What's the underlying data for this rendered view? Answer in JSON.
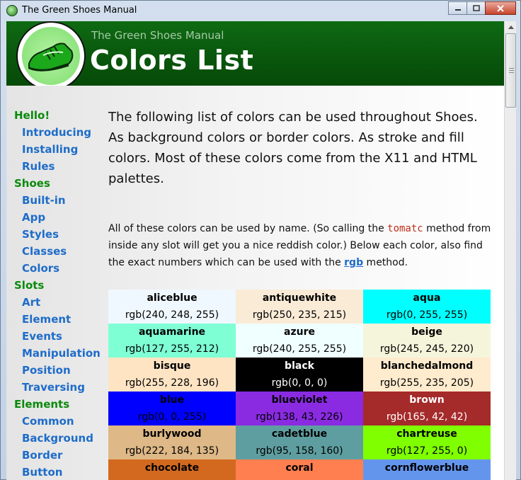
{
  "window": {
    "title": "The Green Shoes Manual",
    "buttons": {
      "minimize": "–",
      "maximize": "□",
      "close": "x"
    }
  },
  "header": {
    "subtitle": "The Green Shoes Manual",
    "title": "Colors List",
    "logo_icon": "green-shoe-logo",
    "accent": "#0a5a0e"
  },
  "sidebar": {
    "sections": [
      {
        "label": "Hello!",
        "items": [
          "Introducing",
          "Installing",
          "Rules"
        ]
      },
      {
        "label": "Shoes",
        "items": [
          "Built-in",
          "App",
          "Styles",
          "Classes",
          "Colors"
        ]
      },
      {
        "label": "Slots",
        "items": [
          "Art",
          "Element",
          "Events",
          "Manipulation",
          "Position",
          "Traversing"
        ]
      },
      {
        "label": "Elements",
        "items": [
          "Common",
          "Background",
          "Border",
          "Button"
        ]
      }
    ]
  },
  "content": {
    "intro": "The following list of colors can be used throughout Shoes.  As background colors or border colors.  As stroke and fill colors.  Most of these colors come from the X11 and HTML palettes.",
    "para_before_code": "All of these colors can be used by name.  (So calling the ",
    "code": "tomatc",
    "para_after_code": " method from inside any slot will get you a nice reddish color.)  Below each color, also find the exact numbers which can be used with the ",
    "link": "rgb",
    "para_end": " method."
  },
  "colors": [
    {
      "name": "aliceblue",
      "rgb": "rgb(240, 248, 255)",
      "bg": "#f0f8ff",
      "fg": "#000000"
    },
    {
      "name": "antiquewhite",
      "rgb": "rgb(250, 235, 215)",
      "bg": "#faebd7",
      "fg": "#000000"
    },
    {
      "name": "aqua",
      "rgb": "rgb(0, 255, 255)",
      "bg": "#00ffff",
      "fg": "#000000"
    },
    {
      "name": "aquamarine",
      "rgb": "rgb(127, 255, 212)",
      "bg": "#7fffd4",
      "fg": "#000000"
    },
    {
      "name": "azure",
      "rgb": "rgb(240, 255, 255)",
      "bg": "#f0ffff",
      "fg": "#000000"
    },
    {
      "name": "beige",
      "rgb": "rgb(245, 245, 220)",
      "bg": "#f5f5dc",
      "fg": "#000000"
    },
    {
      "name": "bisque",
      "rgb": "rgb(255, 228, 196)",
      "bg": "#ffe4c4",
      "fg": "#000000"
    },
    {
      "name": "black",
      "rgb": "rgb(0, 0, 0)",
      "bg": "#000000",
      "fg": "#ffffff"
    },
    {
      "name": "blanchedalmond",
      "rgb": "rgb(255, 235, 205)",
      "bg": "#ffebcd",
      "fg": "#000000"
    },
    {
      "name": "blue",
      "rgb": "rgb(0, 0, 255)",
      "bg": "#0000ff",
      "fg": "#000000"
    },
    {
      "name": "blueviolet",
      "rgb": "rgb(138, 43, 226)",
      "bg": "#8a2be2",
      "fg": "#000000"
    },
    {
      "name": "brown",
      "rgb": "rgb(165, 42, 42)",
      "bg": "#a52a2a",
      "fg": "#ffffff"
    },
    {
      "name": "burlywood",
      "rgb": "rgb(222, 184, 135)",
      "bg": "#deb887",
      "fg": "#000000"
    },
    {
      "name": "cadetblue",
      "rgb": "rgb(95, 158, 160)",
      "bg": "#5f9ea0",
      "fg": "#000000"
    },
    {
      "name": "chartreuse",
      "rgb": "rgb(127, 255, 0)",
      "bg": "#7fff00",
      "fg": "#000000"
    },
    {
      "name": "chocolate",
      "rgb": "",
      "bg": "#d2691e",
      "fg": "#000000"
    },
    {
      "name": "coral",
      "rgb": "",
      "bg": "#ff7f50",
      "fg": "#000000"
    },
    {
      "name": "cornflowerblue",
      "rgb": "",
      "bg": "#6495ed",
      "fg": "#000000"
    }
  ]
}
